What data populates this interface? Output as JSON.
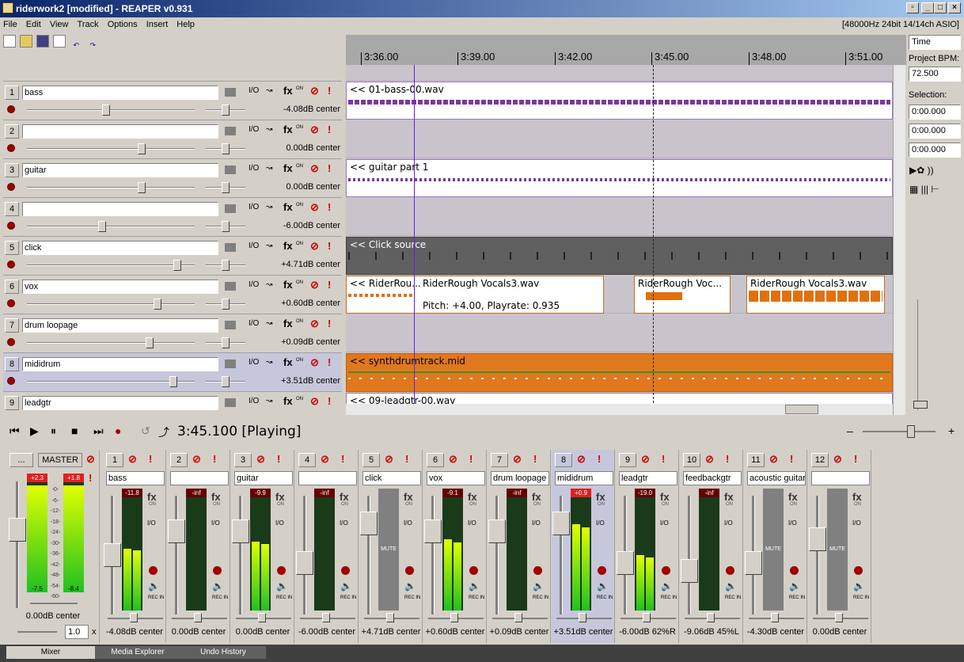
{
  "window": {
    "title": "riderwork2 [modified] - REAPER v0.931",
    "audio_info": "[48000Hz 24bit 14/14ch ASIO]"
  },
  "menu": [
    "File",
    "Edit",
    "View",
    "Track",
    "Options",
    "Insert",
    "Help"
  ],
  "ruler": {
    "labels": [
      "3:36.00",
      "3:39.00",
      "3:42.00",
      "3:45.00",
      "3:48.00",
      "3:51.00"
    ]
  },
  "right_panel": {
    "mode": "Time",
    "bpm_label": "Project BPM:",
    "bpm": "72.500",
    "selection_label": "Selection:",
    "sel_start": "0:00.000",
    "sel_end": "0:00.000",
    "sel_len": "0:00.000"
  },
  "tracks": [
    {
      "num": "1",
      "name": "bass",
      "vol": "-4.08dB center",
      "item": "<< 01-bass-00.wav"
    },
    {
      "num": "2",
      "name": "",
      "vol": "0.00dB center",
      "item": ""
    },
    {
      "num": "3",
      "name": "guitar",
      "vol": "0.00dB center",
      "item": "<< guitar part 1"
    },
    {
      "num": "4",
      "name": "",
      "vol": "-6.00dB center",
      "item": ""
    },
    {
      "num": "5",
      "name": "click",
      "vol": "+4.71dB center",
      "item": "<< Click source"
    },
    {
      "num": "6",
      "name": "vox",
      "vol": "+0.60dB center",
      "item": "<< RiderRou..."
    },
    {
      "num": "7",
      "name": "drum loopage",
      "vol": "+0.09dB center",
      "item": ""
    },
    {
      "num": "8",
      "name": "mididrum",
      "vol": "+3.51dB center",
      "item": "<< synthdrumtrack.mid"
    },
    {
      "num": "9",
      "name": "leadgtr",
      "vol": "",
      "item": "<< 09-leadgtr-00.wav"
    }
  ],
  "vox_items": [
    "RiderRough Vocals3.wav",
    "RiderRough Voc...",
    "RiderRough Vocals3.wav"
  ],
  "pitch_info": "Pitch: +4.00, Playrate: 0.935",
  "transport": {
    "position": "3:45.100 [Playing]"
  },
  "master": {
    "label": "MASTER",
    "peak_l": "+2.3",
    "peak_r": "+1.8",
    "low_l": "-7.5",
    "low_r": "-8.4",
    "vol": "0.00dB center",
    "rate": "1.0",
    "rate_x": "x",
    "btn": "...",
    "scale": [
      "-0-",
      "-6-",
      "-12-",
      "-18-",
      "-24-",
      "-30-",
      "-36-",
      "-42-",
      "-48-",
      "-54-",
      "-60-"
    ]
  },
  "mixer": [
    {
      "num": "1",
      "name": "bass",
      "peak": "-11.8",
      "vol": "-4.08dB center",
      "level": 0.56,
      "mute": false
    },
    {
      "num": "2",
      "name": "",
      "peak": "-inf",
      "vol": "0.00dB center",
      "level": 0,
      "mute": false
    },
    {
      "num": "3",
      "name": "guitar",
      "peak": "-9.9",
      "vol": "0.00dB center",
      "level": 0.62,
      "mute": false
    },
    {
      "num": "4",
      "name": "",
      "peak": "-inf",
      "vol": "-6.00dB center",
      "level": 0,
      "mute": false
    },
    {
      "num": "5",
      "name": "click",
      "peak": "",
      "vol": "+4.71dB center",
      "level": 0,
      "mute": true
    },
    {
      "num": "6",
      "name": "vox",
      "peak": "-9.1",
      "vol": "+0.60dB center",
      "level": 0.64,
      "mute": false
    },
    {
      "num": "7",
      "name": "drum loopage",
      "peak": "-inf",
      "vol": "+0.09dB center",
      "level": 0,
      "mute": false
    },
    {
      "num": "8",
      "name": "mididrum",
      "peak": "+0.9",
      "vol": "+3.51dB center",
      "level": 0.78,
      "mute": false
    },
    {
      "num": "9",
      "name": "leadgtr",
      "peak": "-19.0",
      "vol": "-6.00dB 62%R",
      "level": 0.5,
      "mute": false
    },
    {
      "num": "10",
      "name": "feedbackgtr",
      "peak": "-inf",
      "vol": "-9.06dB 45%L",
      "level": 0,
      "mute": false
    },
    {
      "num": "11",
      "name": "acoustic guitar",
      "peak": "",
      "vol": "-4.30dB center",
      "level": 0,
      "mute": true
    },
    {
      "num": "12",
      "name": "",
      "peak": "",
      "vol": "0.00dB center",
      "level": 0,
      "mute": true
    }
  ],
  "labels": {
    "fx": "fx",
    "on": "ON",
    "off": "OFF",
    "io": "I/O",
    "mute": "MUTE",
    "recin": "REC IN"
  },
  "tabs": [
    "Mixer",
    "Media Explorer",
    "Undo History"
  ]
}
